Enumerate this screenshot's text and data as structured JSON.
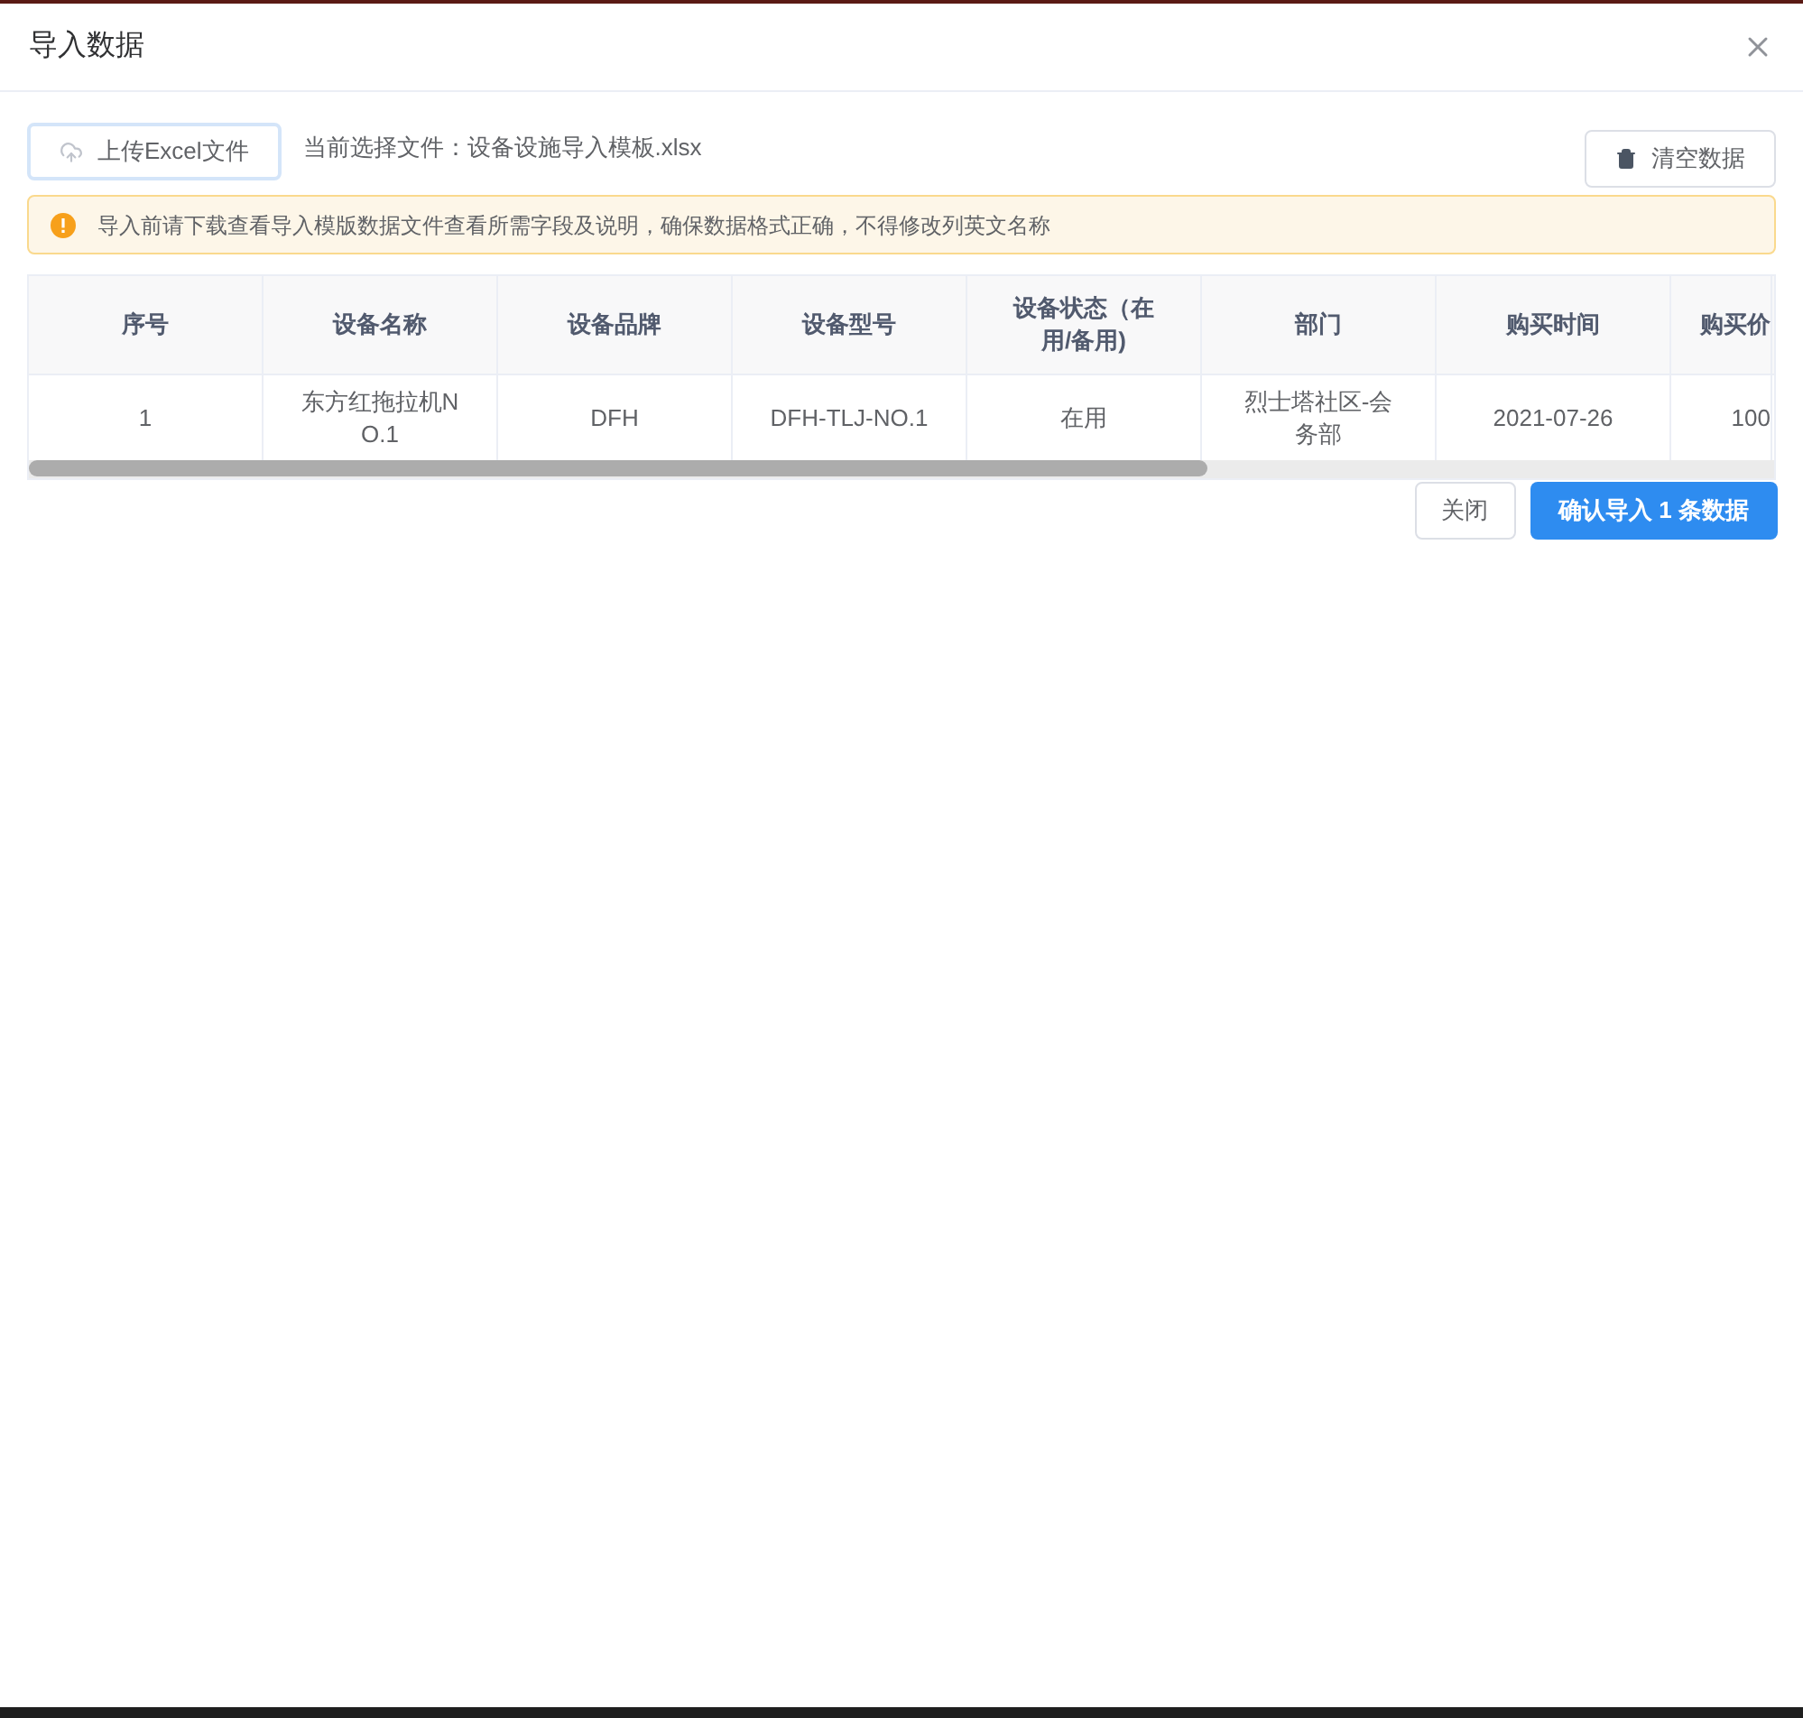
{
  "dialog": {
    "title": "导入数据"
  },
  "toolbar": {
    "upload_button": "上传Excel文件",
    "current_file": "当前选择文件：设备设施导入模板.xlsx",
    "clear_button": "清空数据"
  },
  "alert": {
    "text": "导入前请下载查看导入模版数据文件查看所需字段及说明，确保数据格式正确，不得修改列英文名称"
  },
  "table": {
    "columns": [
      "序号",
      "设备名称",
      "设备品牌",
      "设备型号",
      "设备状态（在用/备用)",
      "部门",
      "购买时间",
      "购买价"
    ],
    "rows": [
      [
        "1",
        "东方红拖拉机NO.1",
        "DFH",
        "DFH-TLJ-NO.1",
        "在用",
        "烈士塔社区-会务部",
        "2021-07-26",
        "100"
      ]
    ]
  },
  "footer": {
    "close_button": "关闭",
    "confirm_button": "确认导入 1 条数据"
  }
}
